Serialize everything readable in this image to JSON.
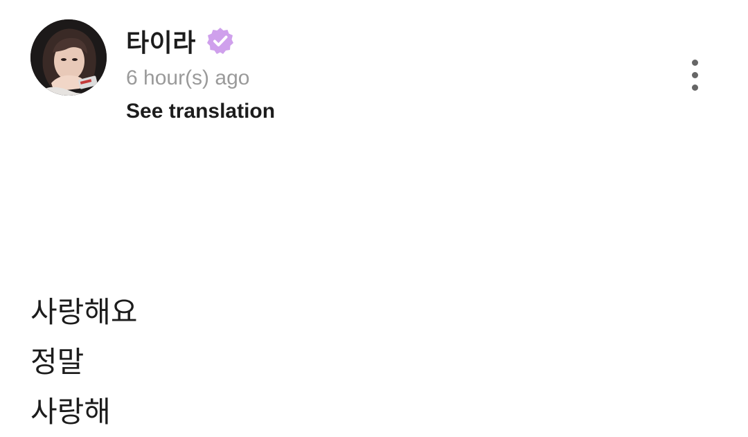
{
  "post": {
    "author": {
      "name": "타이라",
      "verified": true,
      "badge_color": "#cfa0ec"
    },
    "timestamp": "6 hour(s) ago",
    "translate_label": "See translation",
    "more_icon": "more-vertical-icon",
    "body_lines": [
      "사랑해요",
      "정말",
      "사랑해"
    ]
  }
}
